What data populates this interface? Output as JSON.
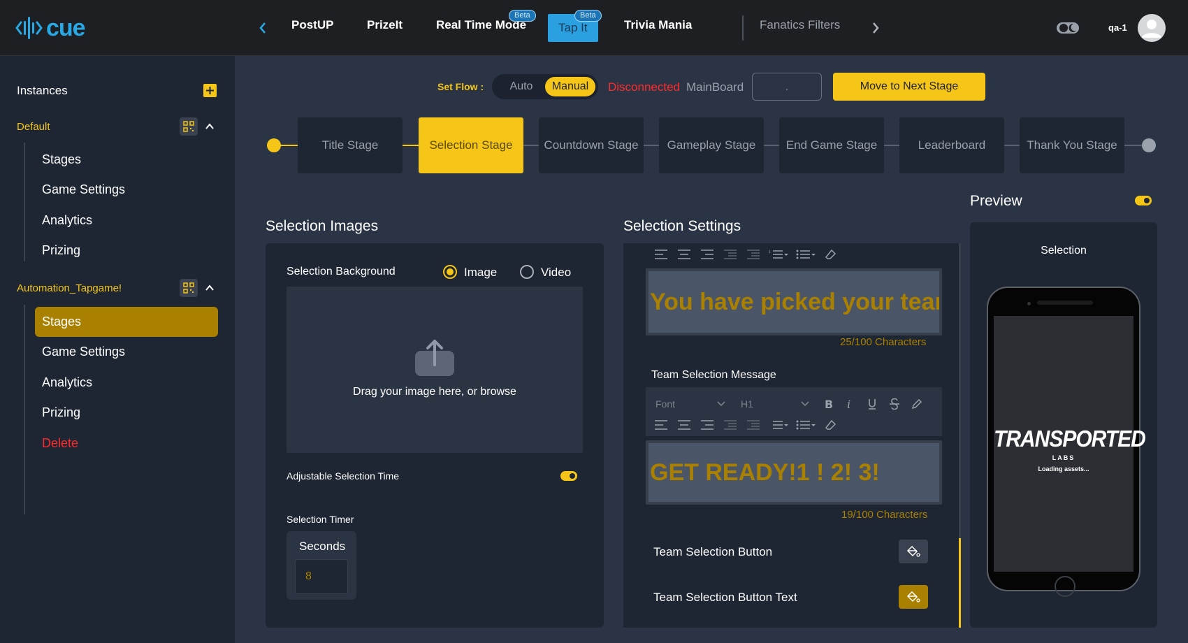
{
  "app": {
    "brand": "cue"
  },
  "nav": {
    "items": [
      {
        "label": "PostUP",
        "beta": ""
      },
      {
        "label": "PrizeIt",
        "beta": ""
      },
      {
        "label": "Real Time Mode",
        "beta": "Beta"
      },
      {
        "label": "Tap It",
        "beta": "Beta"
      },
      {
        "label": "Trivia Mania",
        "beta": ""
      },
      {
        "label": "Fanatics Filters",
        "beta": ""
      }
    ],
    "active": "Tap It"
  },
  "user": {
    "name": "qa-1"
  },
  "sidebar": {
    "title": "Instances",
    "groups": [
      {
        "name": "Default",
        "items": [
          "Stages",
          "Game Settings",
          "Analytics",
          "Prizing"
        ]
      },
      {
        "name": "Automation_Tapgame!",
        "items": [
          "Stages",
          "Game Settings",
          "Analytics",
          "Prizing",
          "Delete"
        ],
        "selected": "Stages"
      }
    ]
  },
  "flow": {
    "label": "Set Flow :",
    "options": [
      "Auto",
      "Manual"
    ],
    "selected": "Manual",
    "status": "Disconnected",
    "board": "MainBoard",
    "board_input": ".",
    "next_button": "Move to Next Stage"
  },
  "stages": {
    "list": [
      "Title Stage",
      "Selection Stage",
      "Countdown Stage",
      "Gameplay Stage",
      "End Game Stage",
      "Leaderboard",
      "Thank You Stage"
    ],
    "current": "Selection Stage"
  },
  "images": {
    "title": "Selection Images",
    "background_label": "Selection Background",
    "media_options": [
      "Image",
      "Video"
    ],
    "media_selected": "Image",
    "drop_text": "Drag your image here, or browse",
    "adjustable_label": "Adjustable Selection Time",
    "adjustable_on": true,
    "timer_label": "Selection Timer",
    "timer_unit": "Seconds",
    "timer_value": "8"
  },
  "settings": {
    "title": "Selection Settings",
    "editor1": {
      "text": "You have picked your team",
      "count": "25/100 Characters"
    },
    "message_label": "Team Selection Message",
    "font_placeholder": "Font",
    "heading_value": "H1",
    "editor2": {
      "text": "GET READY!1 ! 2! 3!",
      "count": "19/100 Characters"
    },
    "button_label": "Team Selection Button",
    "button_text_label": "Team Selection Button Text"
  },
  "preview": {
    "title": "Preview",
    "enabled": true,
    "label": "Selection",
    "brand": "TRANSPORTED",
    "brand_sub": "LABS",
    "loading": "Loading assets..."
  },
  "colors": {
    "accent": "#f5c518",
    "nav_active": "#2aa0e0",
    "danger": "#ff2b2b",
    "brand_blue": "#29a8e6"
  }
}
